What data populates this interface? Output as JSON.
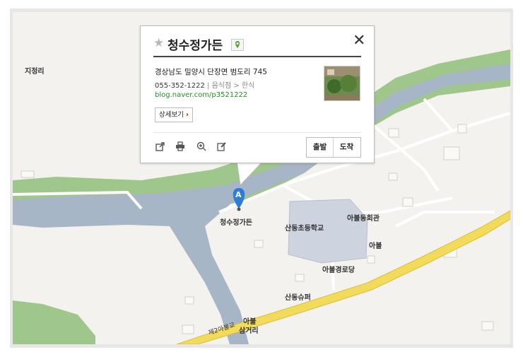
{
  "popup": {
    "title": "청수정가든",
    "address": "경상남도 밀양시 단장면 범도리 745",
    "phone": "055-352-1222",
    "category": "음식점 > 한식",
    "blog": "blog.naver.com/p3521222",
    "detail_label": "상세보기",
    "depart_label": "출발",
    "arrive_label": "도착"
  },
  "map_labels": {
    "village": "지정리",
    "marker_letter": "A",
    "restaurant": "청수정가든",
    "school": "산동초등학교",
    "hall": "아불동회관",
    "abul": "아불",
    "senior": "아불경로당",
    "super": "산동슈퍼",
    "junction_a": "아불",
    "junction_b": "삼거리",
    "bridge": "제2아불교"
  },
  "colors": {
    "river": "#a7b6c6",
    "green": "#a0c78b",
    "land": "#f3f2ee",
    "road": "#f2da5a"
  }
}
